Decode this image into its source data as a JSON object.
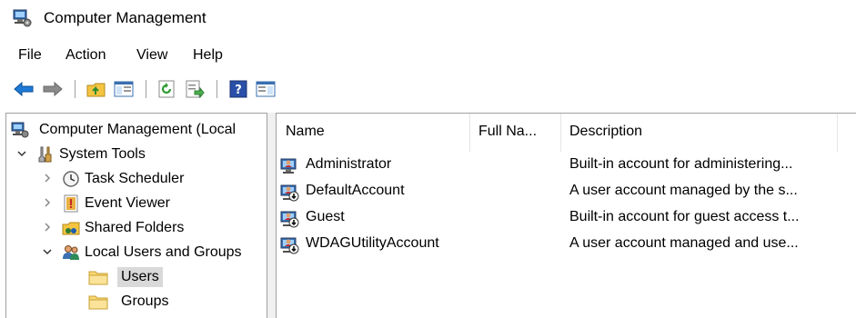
{
  "window": {
    "title": "Computer Management"
  },
  "menu": [
    {
      "label": "File"
    },
    {
      "label": "Action"
    },
    {
      "label": "View"
    },
    {
      "label": "Help"
    }
  ],
  "toolbar": {
    "buttons": [
      "back-arrow-icon",
      "forward-arrow-icon",
      "up-folder-icon",
      "show-hide-console-tree-icon",
      "refresh-icon",
      "export-list-icon",
      "help-icon",
      "show-hide-action-pane-icon"
    ]
  },
  "tree": {
    "root": {
      "label": "Computer Management (Local"
    },
    "system_tools": {
      "label": "System Tools"
    },
    "task_scheduler": {
      "label": "Task Scheduler"
    },
    "event_viewer": {
      "label": "Event Viewer"
    },
    "shared_folders": {
      "label": "Shared Folders"
    },
    "local_users": {
      "label": "Local Users and Groups"
    },
    "users": {
      "label": "Users"
    },
    "groups": {
      "label": "Groups"
    }
  },
  "list": {
    "columns": {
      "name": "Name",
      "fullname": "Full Na...",
      "description": "Description"
    },
    "rows": [
      {
        "name": "Administrator",
        "fullname": "",
        "description": "Built-in account for administering..."
      },
      {
        "name": "DefaultAccount",
        "fullname": "",
        "description": "A user account managed by the s..."
      },
      {
        "name": "Guest",
        "fullname": "",
        "description": "Built-in account for guest access t..."
      },
      {
        "name": "WDAGUtilityAccount",
        "fullname": "",
        "description": "A user account managed and use..."
      }
    ]
  },
  "colors": {
    "selected_bg": "#d9d9d9",
    "border": "#a0a0a0",
    "nav_arrow_blue": "#1e7ad6"
  }
}
